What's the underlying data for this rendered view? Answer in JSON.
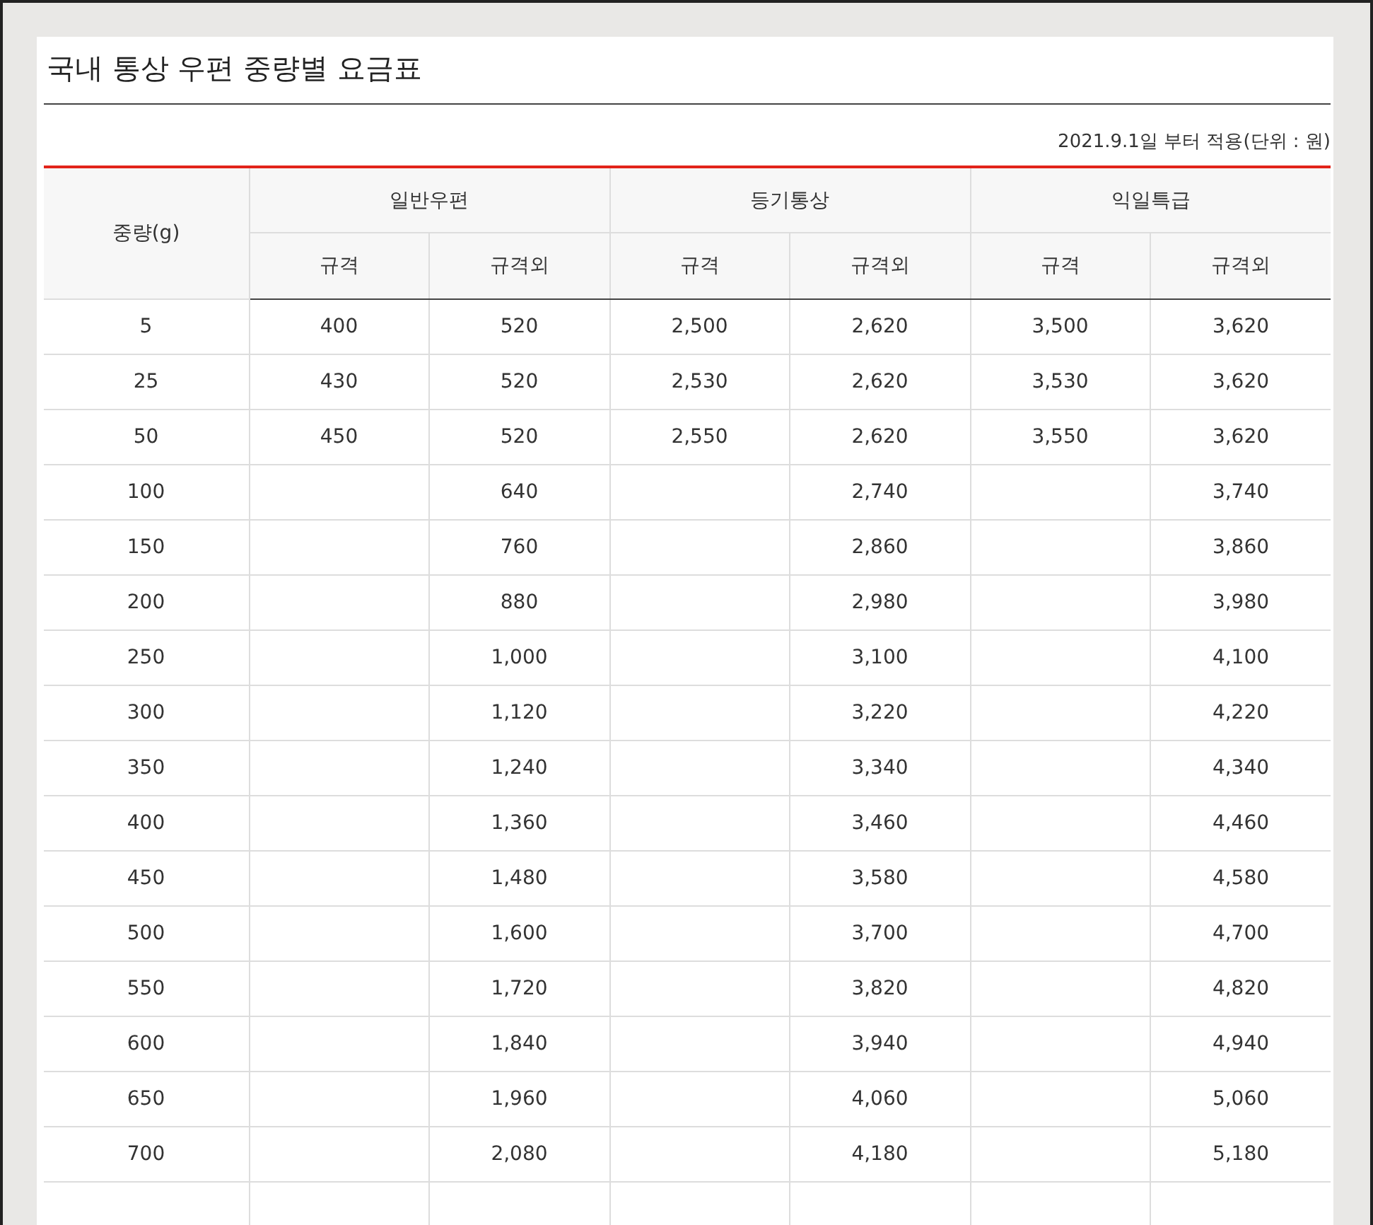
{
  "title": "국내 통상 우편 중량별 요금표",
  "note": "2021.9.1일 부터 적용(단위 : 원)",
  "table": {
    "weight_header": "중량(g)",
    "groups": [
      {
        "label": "일반우편",
        "columns": [
          "규격",
          "규격외"
        ]
      },
      {
        "label": "등기통상",
        "columns": [
          "규격",
          "규격외"
        ]
      },
      {
        "label": "익일특급",
        "columns": [
          "규격",
          "규격외"
        ]
      }
    ],
    "rows": [
      {
        "cells": [
          "5",
          "400",
          "520",
          "2,500",
          "2,620",
          "3,500",
          "3,620"
        ]
      },
      {
        "cells": [
          "25",
          "430",
          "520",
          "2,530",
          "2,620",
          "3,530",
          "3,620"
        ]
      },
      {
        "cells": [
          "50",
          "450",
          "520",
          "2,550",
          "2,620",
          "3,550",
          "3,620"
        ]
      },
      {
        "cells": [
          "100",
          null,
          "640",
          null,
          "2,740",
          null,
          "3,740"
        ]
      },
      {
        "cells": [
          "150",
          null,
          "760",
          null,
          "2,860",
          null,
          "3,860"
        ]
      },
      {
        "cells": [
          "200",
          null,
          "880",
          null,
          "2,980",
          null,
          "3,980"
        ]
      },
      {
        "cells": [
          "250",
          null,
          "1,000",
          null,
          "3,100",
          null,
          "4,100"
        ]
      },
      {
        "cells": [
          "300",
          null,
          "1,120",
          null,
          "3,220",
          null,
          "4,220"
        ]
      },
      {
        "cells": [
          "350",
          null,
          "1,240",
          null,
          "3,340",
          null,
          "4,340"
        ]
      },
      {
        "cells": [
          "400",
          null,
          "1,360",
          null,
          "3,460",
          null,
          "4,460"
        ]
      },
      {
        "cells": [
          "450",
          null,
          "1,480",
          null,
          "3,580",
          null,
          "4,580"
        ]
      },
      {
        "cells": [
          "500",
          null,
          "1,600",
          null,
          "3,700",
          null,
          "4,700"
        ]
      },
      {
        "cells": [
          "550",
          null,
          "1,720",
          null,
          "3,820",
          null,
          "4,820"
        ]
      },
      {
        "cells": [
          "600",
          null,
          "1,840",
          null,
          "3,940",
          null,
          "4,940"
        ]
      },
      {
        "cells": [
          "650",
          null,
          "1,960",
          null,
          "4,060",
          null,
          "5,060"
        ]
      },
      {
        "cells": [
          "700",
          null,
          "2,080",
          null,
          "4,180",
          null,
          "5,180"
        ]
      }
    ]
  }
}
